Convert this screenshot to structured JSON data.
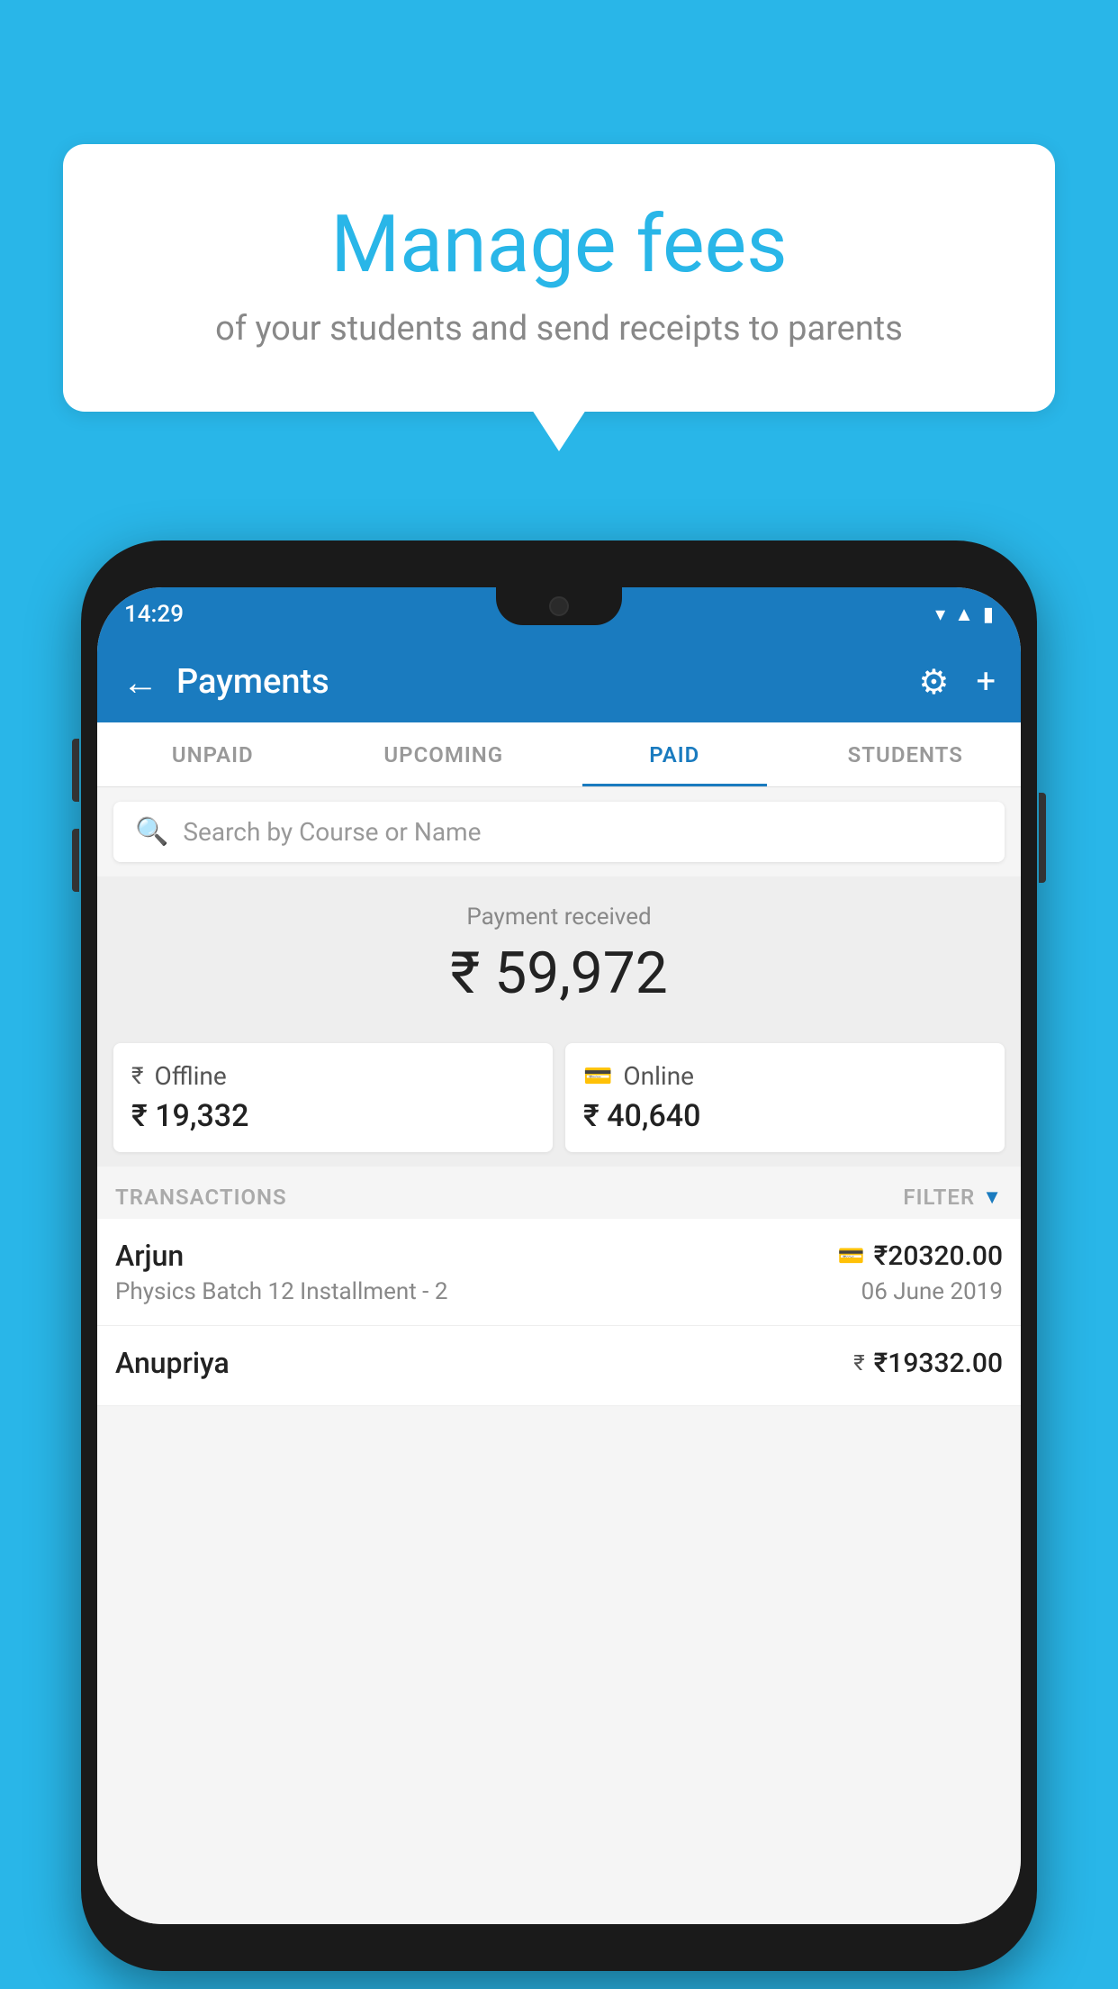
{
  "background_color": "#29b6e8",
  "speech_bubble": {
    "title": "Manage fees",
    "subtitle": "of your students and send receipts to parents"
  },
  "phone": {
    "status_bar": {
      "time": "14:29",
      "icons": [
        "wifi",
        "signal",
        "battery"
      ]
    },
    "app_bar": {
      "title": "Payments",
      "back_label": "←",
      "gear_label": "⚙",
      "plus_label": "+"
    },
    "tabs": [
      {
        "label": "UNPAID",
        "active": false
      },
      {
        "label": "UPCOMING",
        "active": false
      },
      {
        "label": "PAID",
        "active": true
      },
      {
        "label": "STUDENTS",
        "active": false
      }
    ],
    "search": {
      "placeholder": "Search by Course or Name"
    },
    "payment_received": {
      "label": "Payment received",
      "amount": "₹ 59,972"
    },
    "payment_cards": [
      {
        "type": "Offline",
        "amount": "₹ 19,332",
        "icon": "₹"
      },
      {
        "type": "Online",
        "amount": "₹ 40,640",
        "icon": "▬"
      }
    ],
    "transactions_label": "TRANSACTIONS",
    "filter_label": "FILTER",
    "transactions": [
      {
        "name": "Arjun",
        "course": "Physics Batch 12 Installment - 2",
        "amount": "₹20320.00",
        "date": "06 June 2019",
        "payment_type": "online"
      },
      {
        "name": "Anupriya",
        "course": "",
        "amount": "₹19332.00",
        "date": "",
        "payment_type": "offline"
      }
    ]
  }
}
